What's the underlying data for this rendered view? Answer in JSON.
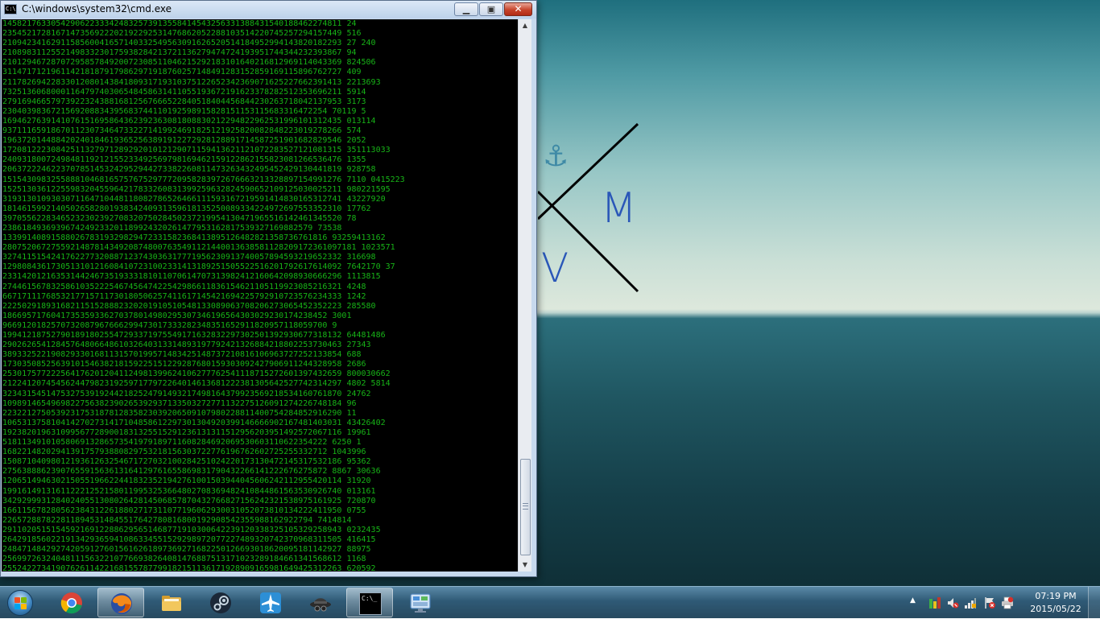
{
  "window": {
    "title": "C:\\windows\\system32\\cmd.exe",
    "icon_label": "C:\\",
    "minimize_glyph": "▁",
    "maximize_glyph": "▣",
    "close_glyph": "✕"
  },
  "console": {
    "text_color": "#17b317",
    "background_color": "#000000",
    "lines": [
      "1458217633054290622333424832573913558414543256331388431540188462274811 24",
      "2354521728167147356922202192292531476862052288103514220745257294157449 516",
      "2109423416291158560041657140332549563091626520514184952994143820182293 27 240",
      "2108983112552149833230175938284213721136279474724193951744344232393867 94",
      "2101294672870729585784920072308511046215292183101640216812969114043369 824506",
      "3114717121961142181879179862971918760257148491283152859169115896762727 409",
      "2117826942283301208014384180931719310375122652342369071625227662391413 2213693",
      "7325136068000116479740306548458631411055193672191623378282512353696211 5914",
      "2791694665797392232438816812567666522840518404456844230263718042137953 3173",
      "2304039836721569208834395683744110192598915828151153115683316472254 70119 5",
      "1694627639141076151695864362392363081808830212294822962531996101312435 013114",
      "9371116591867011230734647332271419924691825121925820082848223019278266 574",
      "1963720144884202401846193652563891912272928128891714587251901682829546 2052",
      "1720812223084251132797128929201012129071159413621121072283527121081315 351113033",
      "2409318007249848119212155233492569798169462159122862155823081266536476 1355",
      "2063722246223707851453242952944273382260811473263432495452429130441819 928758",
      "1515430983255888104681657576752977720958283972676663213328897154991276 7110 0415223",
      "1525130361225598320455964217833260831399259632824590652109125030025211 980221595",
      "3193130109303071164710448118082786526466111593167219591414830165312741 43227920",
      "1814615992140502658280193834240931359618135250089334224972697553352310 17762",
      "3970556228346523230239270832075028450237219954130471965516142461345520 78",
      "2386184936939674249233201189924320261477953162817539327169882579 73538",
      "1339914089158802678319329829472331582368413895126482821358736761816 93259413162",
      "2807520672755921487814349208748007635491121440013638581128209172361097181 1023571",
      "3274115154241762277320887123743036317771956230913740057894593219652332 316698",
      "1298084361730513101216084107231002331413189251505522516201792617614092 7642170 37",
      "2331420121635314424673519333181011070614707313982412160642098930666296 1113815",
      "2744615678325861035222546745647422542986611836154621105119923085216321 4248",
      "6671711176853217715711730180506257411617145421694225792910723576234333 1242",
      "2225029189316821151528882320201910510548133089063708206273065452352223 285580",
      "1866957176041735359336270378014980295307346196564303029230174238452 3001",
      "9669120182570732087967666299473017333282348351652911820957118059700 9",
      "1994121875279018918025547293371975549171632832297302501392930677318132 64481486",
      "2902626541284576480664861032640313314893197792421326884218802253730463 27343",
      "3893325221908293301681131570199571483425148737210816106963727252133854 688",
      "1730350852563910154638218159225151229287680159303092427906911244328958 2686",
      "2530175772225641762012041124981399624106277762541118715272601397432659 800030662",
      "2122412074545624479823192597177972264014613681222381305642527742314297 4802 5814",
      "3234315451475327539192442182524791493217498164379923569218534160761870 24762",
      "1098914654969822756382390265392937133503272771132275126091274226748184 96",
      "2232212750539231753187812835823039206509107980228811400754284852916290 11",
      "1065313758104142702731417104858612297301304920399146666902167481403031 43426402",
      "1923820196310995677289001831325515291236131311512956203951492572067116 19961",
      "5181134910105806913286573541979189711608284692069530603110622354222 6250 1",
      "1682214820294139175793880829753218156303722776196762602725255332712 1043996",
      "1508710409801219361263254671727032100284251024220173130472145317532186 95362",
      "2756388862390765591563613164129761655869831790432266141222676275872 8867 30636",
      "1206514946302150551966224418323521942761001503944045606242112955420114 31920",
      "1991614913161122212521580119953253664802708369482410844861563530926740 013161",
      "3429299931284024055130802642814506857870432766827156242321538975161925 720870",
      "1661156782805623843122618802717311077196062930031052073810134222411950 0755",
      "2265728878228118945314845517642780816800192908542355988162922794 7414814",
      "2911020515154592169122886295651468771910300642239120338325105329258943 0232435",
      "2642918560221913429365941086334551529298972077227489320742370968311505 416415",
      "2484714842927420591276015616261897369271682250126693018620095181142927 88975",
      "2569972632404811156322107766938264081476887513171023289184661341568612 1168",
      "2552422734190762611422168155787799182151136171928909165981649425312263 620592"
    ]
  },
  "desktop_logo": {
    "letter_m": "M",
    "letter_v": "V",
    "anchor": "⚓"
  },
  "taskbar": {
    "pinned": [
      {
        "name": "chrome"
      },
      {
        "name": "firefox"
      },
      {
        "name": "file-explorer"
      },
      {
        "name": "steam"
      },
      {
        "name": "airplane-app"
      },
      {
        "name": "spy-app"
      },
      {
        "name": "command-prompt"
      },
      {
        "name": "control-panel"
      }
    ],
    "cmd_icon_label": "C:\\_",
    "tray_expand": "▲",
    "clock_time": "07:19 PM",
    "clock_date": "2015/05/22"
  }
}
